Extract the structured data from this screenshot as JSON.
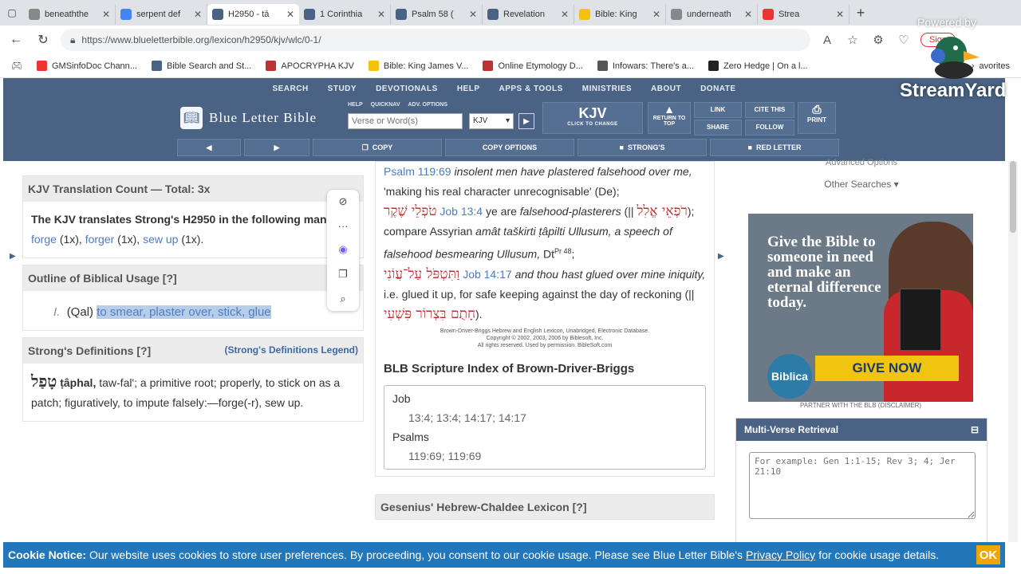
{
  "browser": {
    "tabs": [
      {
        "title": "beneaththe",
        "color": "#888"
      },
      {
        "title": "serpent def",
        "color": "#4285f4"
      },
      {
        "title": "H2950 - tā",
        "color": "#4a6385",
        "active": true
      },
      {
        "title": "1 Corinthia",
        "color": "#4a6385"
      },
      {
        "title": "Psalm 58 (",
        "color": "#4a6385"
      },
      {
        "title": "Revelation",
        "color": "#4a6385"
      },
      {
        "title": "Bible: King",
        "color": "#f4c20d"
      },
      {
        "title": "underneath",
        "color": "#888"
      },
      {
        "title": "Strea",
        "color": "#e33"
      }
    ],
    "url": "https://www.blueletterbible.org/lexicon/h2950/kjv/wlc/0-1/",
    "signin": "Sign",
    "bookmarks": [
      {
        "label": "GMSinfoDoc Chann...",
        "color": "#e33"
      },
      {
        "label": "Bible Search and St...",
        "color": "#4a6385"
      },
      {
        "label": "APOCRYPHA KJV",
        "color": "#b33"
      },
      {
        "label": "Bible: King James V...",
        "color": "#f4c20d"
      },
      {
        "label": "Online Etymology D...",
        "color": "#b33"
      },
      {
        "label": "Infowars: There's a...",
        "color": "#555"
      },
      {
        "label": "Zero Hedge | On a l...",
        "color": "#222"
      }
    ],
    "favorites": "avorites"
  },
  "overlay": {
    "powered_by": "Powered by",
    "brand": "StreamYard"
  },
  "blb": {
    "topnav": [
      "SEARCH",
      "STUDY",
      "DEVOTIONALS",
      "HELP",
      "APPS & TOOLS",
      "MINISTRIES",
      "ABOUT",
      "DONATE"
    ],
    "logo": "Blue Letter Bible",
    "search_opts": [
      "HELP",
      "QUICKNAV",
      "ADV. OPTIONS"
    ],
    "verse_placeholder": "Verse or Word(s)",
    "version": "KJV",
    "kjv_big": "KJV",
    "kjv_small": "CLICK TO CHANGE",
    "return_top": "RETURN TO TOP",
    "link": "LINK",
    "share": "SHARE",
    "cite": "CITE THIS",
    "follow": "FOLLOW",
    "print": "PRINT",
    "toolbar": [
      "◀",
      "▶",
      "COPY",
      "COPY OPTIONS",
      "STRONG'S",
      "RED LETTER"
    ]
  },
  "left": {
    "count_title": "KJV Translation Count — Total: 3x",
    "count_lead": "The KJV translates Strong's H2950 in the following manner:",
    "count_items": [
      "forge",
      "(1x),",
      "forger",
      "(1x),",
      "sew up",
      "(1x)."
    ],
    "outline_title": "Outline of Biblical Usage [?]",
    "outline_num": "I.",
    "outline_qal": "(Qal)",
    "outline_text": "to smear, plaster over, stick, glue",
    "defs_title": "Strong's Definitions [?]",
    "defs_legend": "(Strong's Definitions Legend)",
    "defs_heb": "טָפַל",
    "defs_translit": "ṭâphal,",
    "defs_text": "taw-fal'; a primitive root; properly, to stick on as a patch; figuratively, to impute falsely:—forge(-r), sew up."
  },
  "middle": {
    "l1_ref": "Psalm 119:69",
    "l1_text": "insolent men have plastered falsehood over me,",
    "l1_tail": "'making his real character unrecognisable' (De);",
    "l2_heb": "טֹפְלֵי שֶׁקֶר",
    "l2_ref": "Job 13:4",
    "l2_text": "ye are",
    "l2_ital": "falsehood-plasterers",
    "l2_tail": "(||",
    "l3_heb": "רֹפְאֵי אֱלִל",
    "l3_text": "); compare Assyrian",
    "l3_ital": "amât taškirti ṭâpilti Ullusum,",
    "l4_ital": "a speech of falsehood besmearing Ullusum,",
    "l4_tail": "Dt",
    "l4_sup": "Pr 48",
    "l5_heb": "וַתִּטְפֹּל עַל־עֲוֹנִי",
    "l5_ref": "Job 14:17",
    "l5_ital": "and thou hast glued over mine iniquity,",
    "l5_tail": "i.e. glued it up, for safe keeping against the day of reckoning (||",
    "l6_heb": "חָתֻם בִּצְרוֹר פִּשְׁעִי",
    "l6_tail": ").",
    "copyright": [
      "Brown-Driver-Briggs Hebrew and English Lexicon, Unabridged, Electronic Database.",
      "Copyright © 2002, 2003, 2006 by Biblesoft, Inc.",
      "All rights reserved. Used by permission. BibleSoft.com"
    ],
    "index_title": "BLB Scripture Index of Brown-Driver-Briggs",
    "index": [
      {
        "book": "Job",
        "refs": "13:4; 13:4; 14:17; 14:17"
      },
      {
        "book": "Psalms",
        "refs": "119:69; 119:69"
      }
    ],
    "gesenius": "Gesenius' Hebrew-Chaldee Lexicon [?]"
  },
  "right": {
    "adv_options": "Advanced Options",
    "other_searches": "Other Searches ▾",
    "ad_text": "Give the Bible to someone in need and make an eternal difference today.",
    "ad_logo": "Biblica",
    "ad_cta": "GIVE NOW",
    "partner": "PARTNER WITH THE BLB   (DISCLAIMER)",
    "mvr_title": "Multi-Verse Retrieval",
    "mvr_placeholder": "For example: Gen 1:1-15; Rev 3; 4; Jer 21:10"
  },
  "cookie": {
    "label": "Cookie Notice:",
    "text": "Our website uses cookies to store user preferences. By proceeding, you consent to our cookie usage. Please see Blue Letter Bible's",
    "link": "Privacy Policy",
    "tail": "for cookie usage details.",
    "ok": "OK"
  }
}
